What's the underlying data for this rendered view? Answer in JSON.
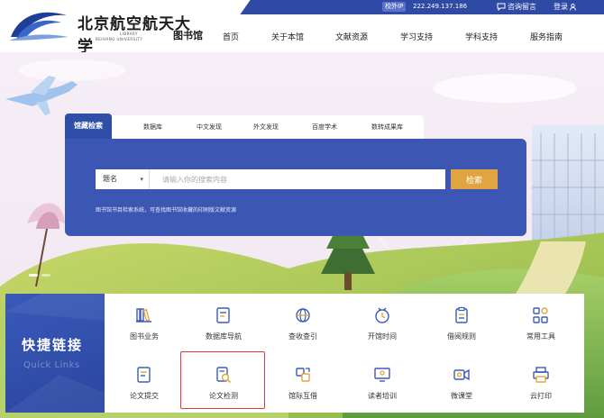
{
  "header": {
    "logo": {
      "title": "北京航空航天大学",
      "sub_library": "LIBRARY",
      "sub_university": "BEIHANG UNIVERSITY",
      "library_name": "图书馆"
    },
    "ip_label": "校外IP",
    "ip_value": "222.249.137.186",
    "consult_label": "咨询留言",
    "login_label": "登录"
  },
  "nav": {
    "items": [
      {
        "label": "首页"
      },
      {
        "label": "关于本馆"
      },
      {
        "label": "文献资源"
      },
      {
        "label": "学习支持"
      },
      {
        "label": "学科支持"
      },
      {
        "label": "服务指南"
      }
    ]
  },
  "search": {
    "tabs": [
      {
        "label": "馆藏检索",
        "active": true
      },
      {
        "label": "数据库"
      },
      {
        "label": "中文发现"
      },
      {
        "label": "外文发现"
      },
      {
        "label": "百度学术"
      },
      {
        "label": "数转成果库"
      }
    ],
    "select_value": "题名",
    "placeholder": "请输入你的搜索内容",
    "button_label": "检索",
    "hint": "图书馆书目检索系统，可查找图书馆收藏的印刷版文献资源"
  },
  "quick_links": {
    "title": "快捷链接",
    "subtitle": "Quick Links",
    "items": [
      {
        "label": "图书业务",
        "icon": "books-icon"
      },
      {
        "label": "数据库导航",
        "icon": "database-nav-icon"
      },
      {
        "label": "查收查引",
        "icon": "citation-search-icon"
      },
      {
        "label": "开馆时间",
        "icon": "clock-icon"
      },
      {
        "label": "借阅规则",
        "icon": "rules-icon"
      },
      {
        "label": "常用工具",
        "icon": "tools-icon"
      },
      {
        "label": "论文提交",
        "icon": "thesis-submit-icon"
      },
      {
        "label": "论文检测",
        "icon": "thesis-check-icon"
      },
      {
        "label": "馆际互借",
        "icon": "interlibrary-loan-icon"
      },
      {
        "label": "读者培训",
        "icon": "training-icon"
      },
      {
        "label": "微课堂",
        "icon": "micro-class-icon"
      },
      {
        "label": "云打印",
        "icon": "printer-icon"
      }
    ]
  },
  "colors": {
    "brand_blue": "#2f4ea8",
    "search_button": "#e0a540",
    "highlight_red": "#e23a3a"
  }
}
